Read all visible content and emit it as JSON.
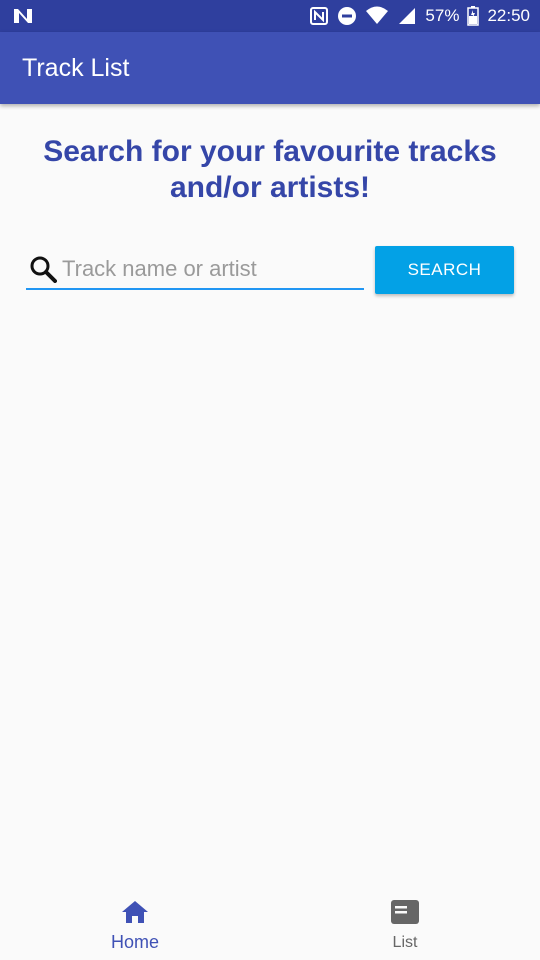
{
  "status_bar": {
    "battery_percent": "57%",
    "time": "22:50",
    "icons": [
      "n-notification-icon",
      "nfc-icon",
      "do-not-disturb-icon",
      "wifi-icon",
      "signal-icon",
      "battery-icon"
    ]
  },
  "app_bar": {
    "title": "Track List"
  },
  "main": {
    "heading": "Search for your favourite tracks and/or artists!",
    "search": {
      "placeholder": "Track name or artist",
      "value": "",
      "button_label": "SEARCH"
    }
  },
  "bottom_nav": {
    "items": [
      {
        "label": "Home",
        "icon": "home-icon",
        "active": true
      },
      {
        "label": "List",
        "icon": "list-icon",
        "active": false
      }
    ]
  },
  "colors": {
    "status_bar": "#2f3f9e",
    "app_bar": "#3f51b5",
    "heading": "#3546a8",
    "search_underline": "#2196f3",
    "search_button": "#03a1e6",
    "active_nav": "#3f51b5",
    "inactive_nav": "#666666",
    "background": "#fafafa"
  }
}
